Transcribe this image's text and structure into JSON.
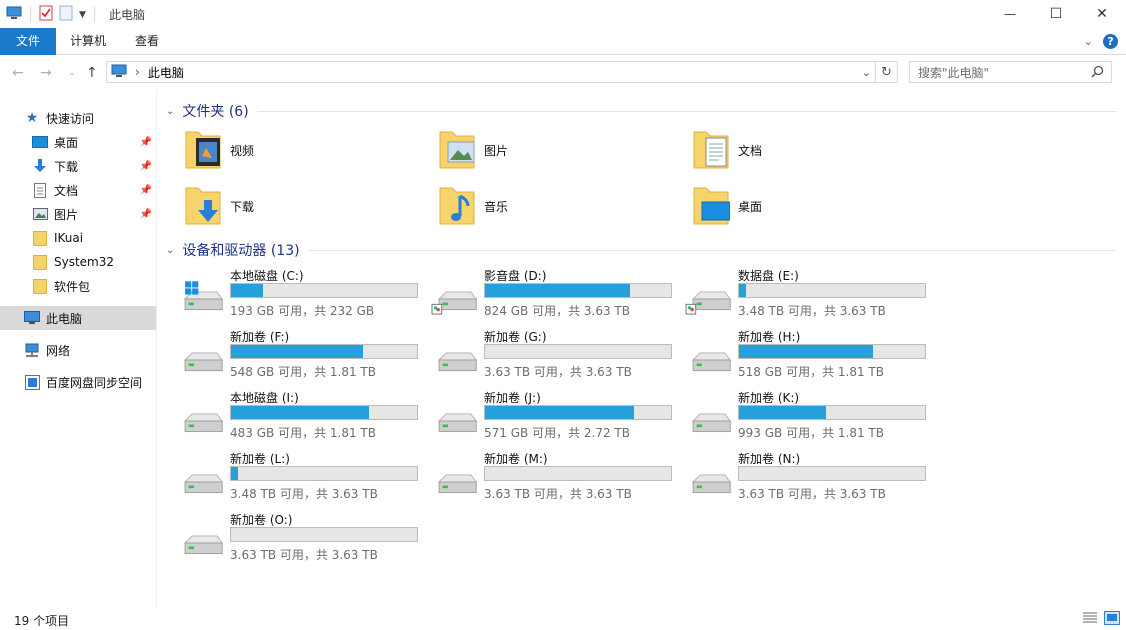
{
  "window": {
    "title": "此电脑",
    "minimize": "—",
    "maximize": "☐",
    "close": "✕"
  },
  "ribbon": {
    "tabs": [
      {
        "label": "文件"
      },
      {
        "label": "计算机"
      },
      {
        "label": "查看"
      }
    ],
    "help": "?"
  },
  "address": {
    "path": "此电脑",
    "separator": "›",
    "search_placeholder": "搜索\"此电脑\""
  },
  "sidebar": {
    "items": [
      {
        "label": "快速访问",
        "icon": "star-icon",
        "pinned": false
      },
      {
        "label": "桌面",
        "icon": "desktop-icon",
        "pinned": true
      },
      {
        "label": "下载",
        "icon": "download-icon",
        "pinned": true
      },
      {
        "label": "文档",
        "icon": "document-icon",
        "pinned": true
      },
      {
        "label": "图片",
        "icon": "picture-icon",
        "pinned": true
      },
      {
        "label": "IKuai",
        "icon": "folder-icon",
        "pinned": false
      },
      {
        "label": "System32",
        "icon": "folder-icon",
        "pinned": false
      },
      {
        "label": "软件包",
        "icon": "folder-icon",
        "pinned": false
      },
      {
        "label": "此电脑",
        "icon": "pc-icon",
        "pinned": false
      },
      {
        "label": "网络",
        "icon": "network-icon",
        "pinned": false
      },
      {
        "label": "百度网盘同步空间",
        "icon": "cloud-icon",
        "pinned": false
      }
    ]
  },
  "folders_section": {
    "title": "文件夹 (6)",
    "items": [
      {
        "label": "视频",
        "icon": "video-folder-icon"
      },
      {
        "label": "图片",
        "icon": "picture-folder-icon"
      },
      {
        "label": "文档",
        "icon": "document-folder-icon"
      },
      {
        "label": "下载",
        "icon": "download-folder-icon"
      },
      {
        "label": "音乐",
        "icon": "music-folder-icon"
      },
      {
        "label": "桌面",
        "icon": "desktop-folder-icon"
      }
    ]
  },
  "drives_section": {
    "title": "设备和驱动器 (13)",
    "items": [
      {
        "name": "本地磁盘 (C:)",
        "info": "193 GB 可用，共 232 GB",
        "used_pct": 17,
        "icon": "system-drive-icon"
      },
      {
        "name": "影音盘 (D:)",
        "info": "824 GB 可用，共 3.63 TB",
        "used_pct": 78,
        "icon": "shared-drive-icon"
      },
      {
        "name": "数据盘 (E:)",
        "info": "3.48 TB 可用，共 3.63 TB",
        "used_pct": 4,
        "icon": "shared-drive-icon"
      },
      {
        "name": "新加卷 (F:)",
        "info": "548 GB 可用，共 1.81 TB",
        "used_pct": 71,
        "icon": "drive-icon"
      },
      {
        "name": "新加卷 (G:)",
        "info": "3.63 TB 可用，共 3.63 TB",
        "used_pct": 0,
        "icon": "drive-icon"
      },
      {
        "name": "新加卷 (H:)",
        "info": "518 GB 可用，共 1.81 TB",
        "used_pct": 72,
        "icon": "drive-icon"
      },
      {
        "name": "本地磁盘 (I:)",
        "info": "483 GB 可用，共 1.81 TB",
        "used_pct": 74,
        "icon": "drive-icon"
      },
      {
        "name": "新加卷 (J:)",
        "info": "571 GB 可用，共 2.72 TB",
        "used_pct": 80,
        "icon": "drive-icon"
      },
      {
        "name": "新加卷 (K:)",
        "info": "993 GB 可用，共 1.81 TB",
        "used_pct": 47,
        "icon": "drive-icon"
      },
      {
        "name": "新加卷 (L:)",
        "info": "3.48 TB 可用，共 3.63 TB",
        "used_pct": 4,
        "icon": "drive-icon"
      },
      {
        "name": "新加卷 (M:)",
        "info": "3.63 TB 可用，共 3.63 TB",
        "used_pct": 0,
        "icon": "drive-icon"
      },
      {
        "name": "新加卷 (N:)",
        "info": "3.63 TB 可用，共 3.63 TB",
        "used_pct": 0,
        "icon": "drive-icon"
      },
      {
        "name": "新加卷 (O:)",
        "info": "3.63 TB 可用，共 3.63 TB",
        "used_pct": 0,
        "icon": "drive-icon"
      }
    ]
  },
  "status": {
    "count": "19 个项目"
  },
  "colors": {
    "accent": "#1979ca",
    "bar_fill": "#26a0da",
    "bar_bg": "#e6e6e6",
    "section_title": "#1e3287",
    "folder": "#f6d36b"
  }
}
